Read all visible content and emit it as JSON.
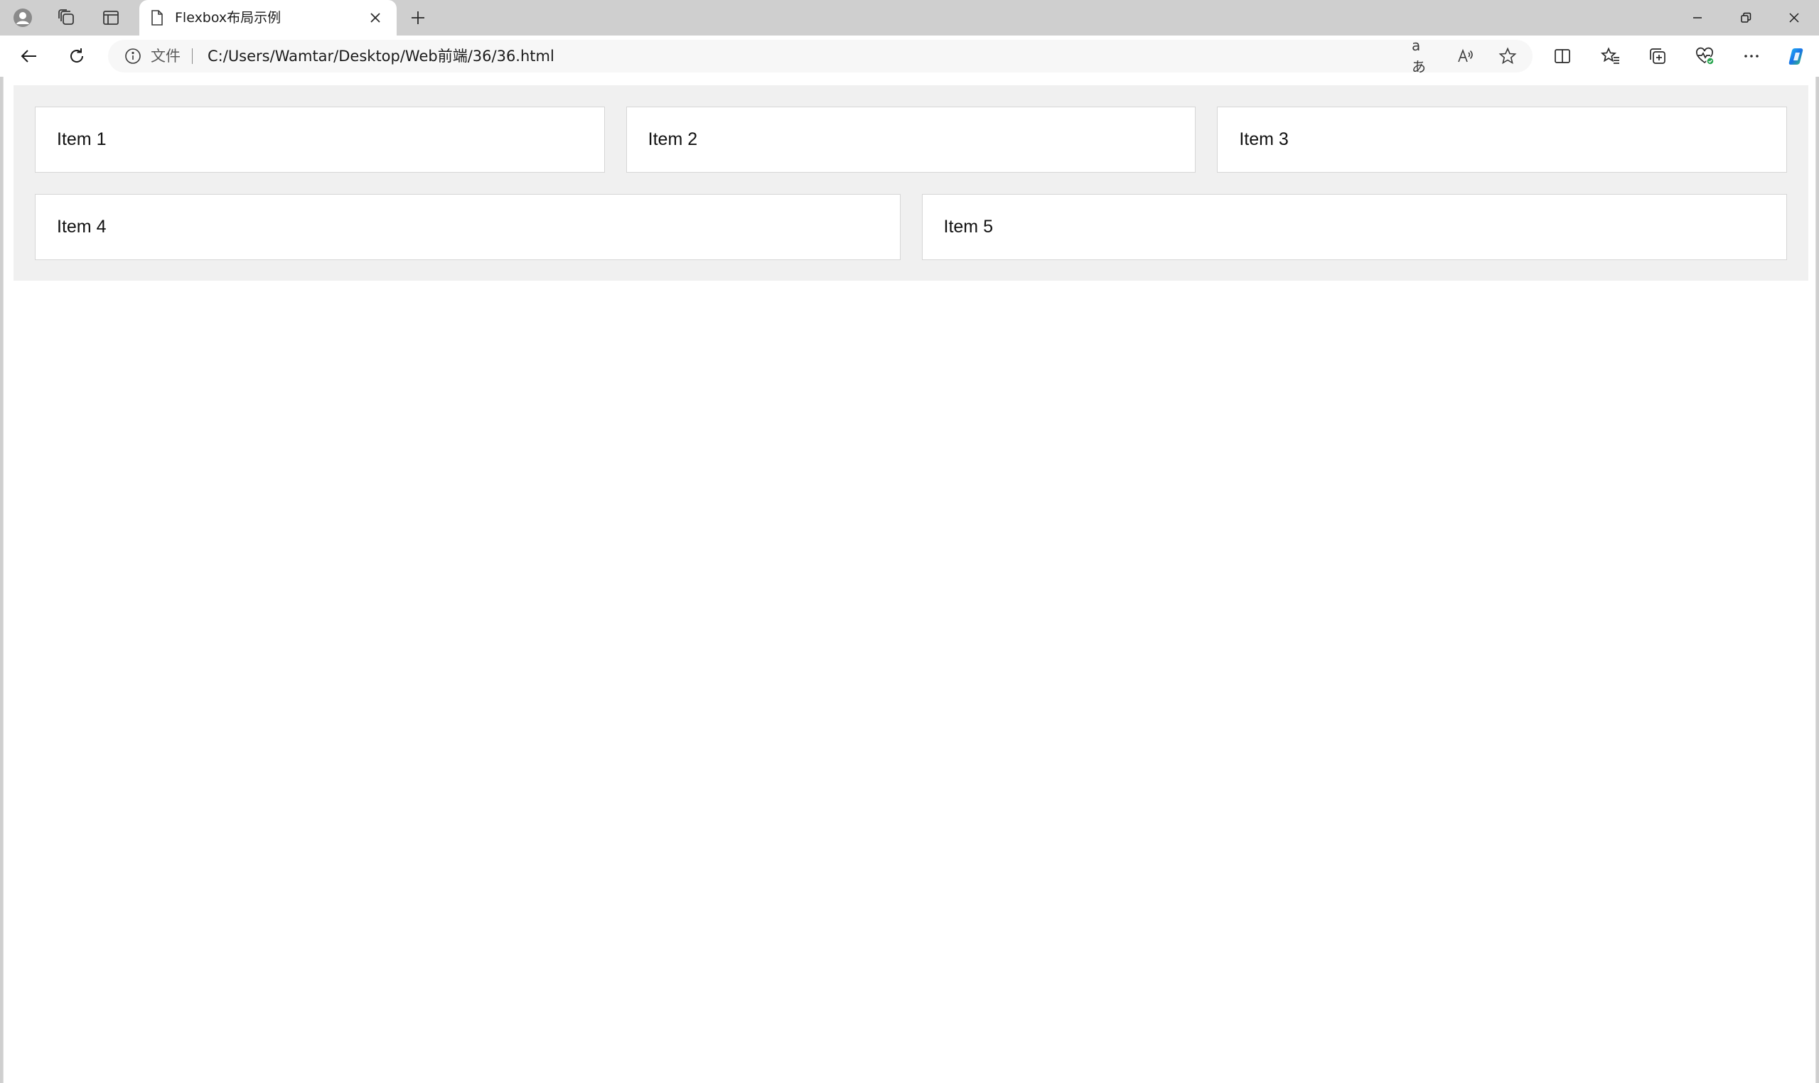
{
  "browser": {
    "tab": {
      "title": "Flexbox布局示例"
    },
    "address": {
      "scheme_label": "文件",
      "url": "C:/Users/Wamtar/Desktop/Web前端/36/36.html"
    },
    "icons": {
      "profile": "profile-icon",
      "workspaces": "workspaces-icon",
      "vertical_tabs": "vertical-tabs-icon",
      "page": "page-icon",
      "close_tab": "close-icon",
      "new_tab": "plus-icon",
      "back": "back-arrow-icon",
      "refresh": "refresh-icon",
      "info": "info-icon",
      "translate": "translate-icon",
      "read_aloud": "read-aloud-icon",
      "favorite": "star-icon",
      "split_screen": "split-screen-icon",
      "favorites": "favorites-icon",
      "collections": "collections-icon",
      "browser_essentials": "heart-pulse-icon",
      "more": "more-icon",
      "copilot": "copilot-icon"
    },
    "translate_glyph": "aあ",
    "read_aloud_glyph": "A)"
  },
  "page": {
    "items": [
      {
        "label": "Item 1"
      },
      {
        "label": "Item 2"
      },
      {
        "label": "Item 3"
      },
      {
        "label": "Item 4"
      },
      {
        "label": "Item 5"
      }
    ]
  },
  "colors": {
    "tabstrip": "#cfcfcf",
    "container_bg": "#f0f0f0",
    "item_border": "#d6d6d6",
    "copilot_accent": "#1a73e8",
    "essentials_badge": "#22a34a"
  }
}
